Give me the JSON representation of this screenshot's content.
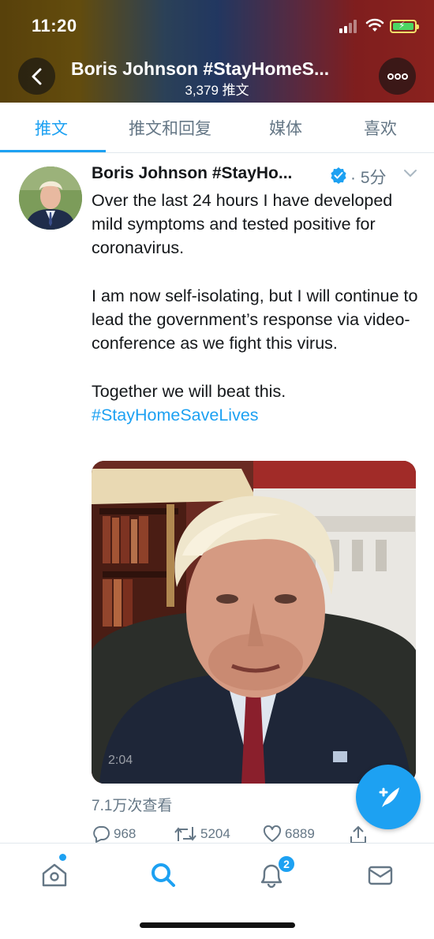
{
  "status_bar": {
    "time": "11:20"
  },
  "header": {
    "title": "Boris Johnson #StayHomeS...",
    "subtitle": "3,379 推文"
  },
  "tabs": [
    {
      "label": "推文",
      "active": true
    },
    {
      "label": "推文和回复",
      "active": false
    },
    {
      "label": "媒体",
      "active": false
    },
    {
      "label": "喜欢",
      "active": false
    }
  ],
  "tweet": {
    "display_name": "Boris Johnson #StayHo...",
    "time": "· 5分",
    "paragraphs": [
      "Over the last 24 hours I have developed mild symptoms and tested positive for coronavirus.",
      "I am now self-isolating, but I will continue to lead the government’s response via video-conference as we fight this virus.",
      "Together we will beat this."
    ],
    "hashtag": "#StayHomeSaveLives",
    "video_duration": "2:04",
    "views": "7.1万次查看",
    "replies": "968",
    "retweets": "5204",
    "likes": "6889"
  },
  "bottom_nav": {
    "notifications_badge": "2"
  },
  "colors": {
    "accent": "#1da1f2",
    "secondary_text": "#657786",
    "primary_text": "#14171a"
  },
  "icons": [
    "back-icon",
    "more-icon",
    "verified-icon",
    "chevron-down-icon",
    "reply-icon",
    "retweet-icon",
    "like-icon",
    "share-icon",
    "compose-icon",
    "home-icon",
    "search-icon",
    "notifications-icon",
    "messages-icon"
  ]
}
